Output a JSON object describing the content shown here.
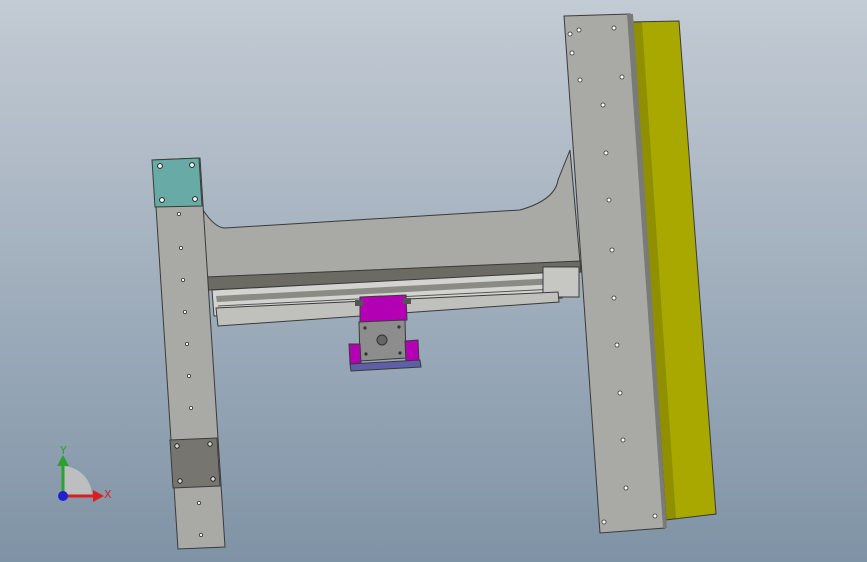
{
  "viewport": {
    "background_top": "#c3cbd4",
    "background_bottom": "#7f93a6"
  },
  "model": {
    "frame_color": "#a9a9a5",
    "frame_edge": "#3a3a3a",
    "base_color": "#a8a800",
    "plate_top_color": "#68aaa6",
    "plate_bottom_color": "#77756f",
    "carriage_color": "#b400b4",
    "motor_color": "#8d8d8d",
    "foot_color": "#5f5fa8"
  },
  "triad": {
    "x_label": "X",
    "y_label": "Y",
    "x_color": "#d92020",
    "y_color": "#2ea02e",
    "origin_color": "#2020d0"
  }
}
